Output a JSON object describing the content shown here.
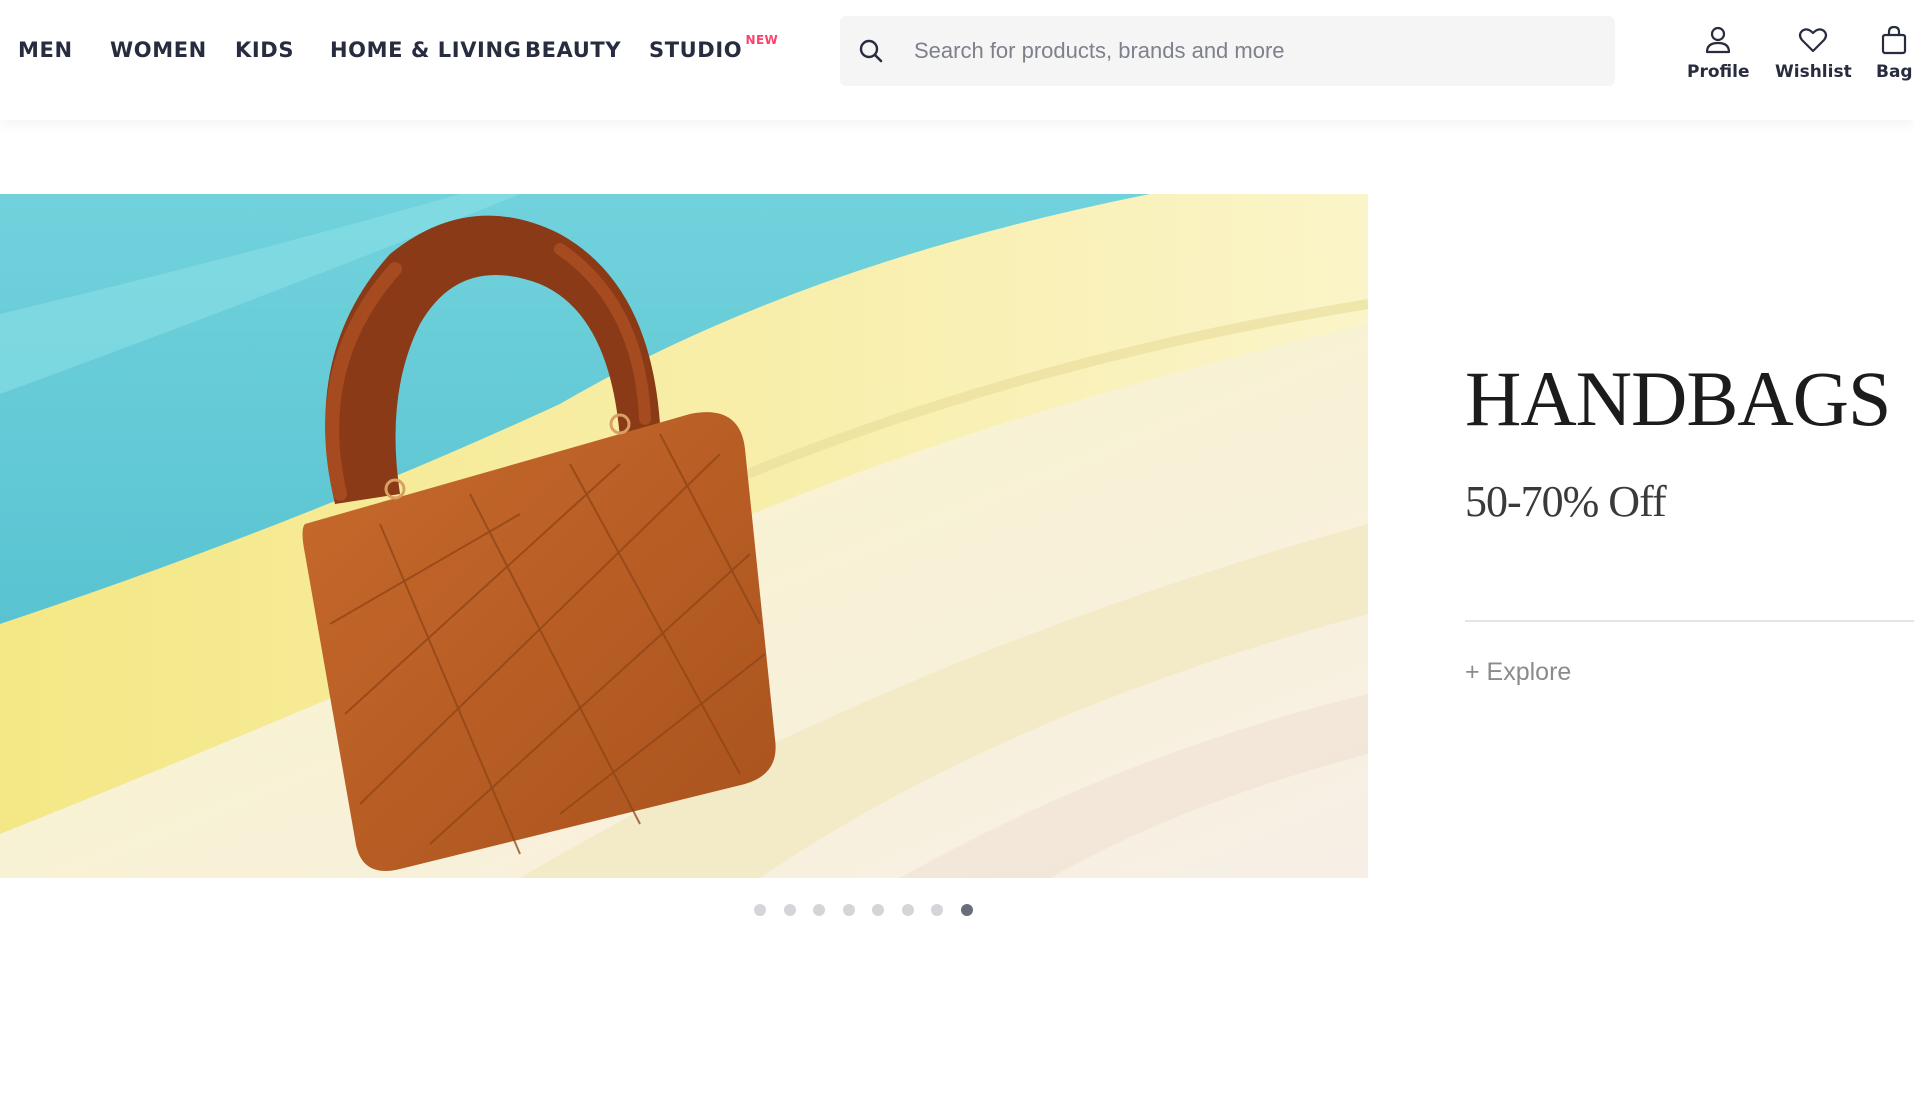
{
  "nav": {
    "items": [
      {
        "label": "MEN"
      },
      {
        "label": "WOMEN"
      },
      {
        "label": "KIDS"
      },
      {
        "label": "HOME & LIVING"
      },
      {
        "label": "BEAUTY"
      },
      {
        "label": "STUDIO",
        "badge": "NEW"
      }
    ]
  },
  "search": {
    "placeholder": "Search for products, brands and more",
    "icon": "search-icon"
  },
  "actions": [
    {
      "label": "Profile",
      "icon": "profile-icon"
    },
    {
      "label": "Wishlist",
      "icon": "heart-icon"
    },
    {
      "label": "Bag",
      "icon": "bag-icon"
    }
  ],
  "banner": {
    "title": "HANDBAGS",
    "offer": "50-70% Off",
    "cta": "+ Explore"
  },
  "carousel": {
    "total_slides": 8,
    "active_index": 7
  },
  "colors": {
    "text_primary": "#282c3f",
    "badge": "#ff3f6c",
    "search_bg": "#f5f5f6",
    "dot_active": "#696e79",
    "dot_inactive": "#d4d5d9"
  }
}
